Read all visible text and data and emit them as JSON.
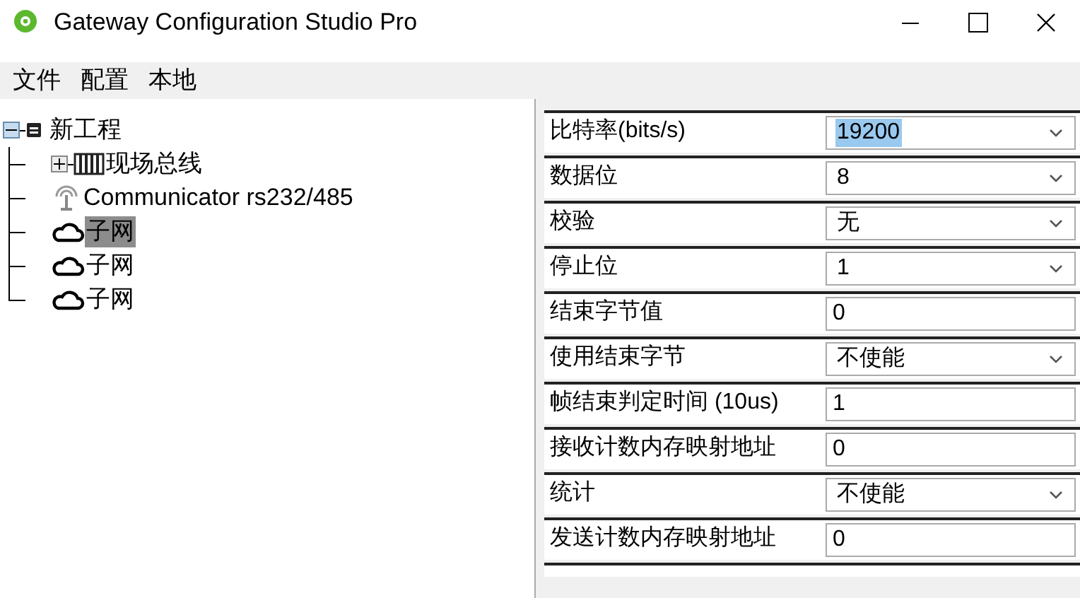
{
  "window": {
    "title": "Gateway Configuration Studio Pro"
  },
  "menu": [
    "文件",
    "配置",
    "本地"
  ],
  "tree": [
    {
      "label": "新工程",
      "kind": "project",
      "expanded": true,
      "selected": false,
      "children": [
        {
          "label": "现场总线",
          "kind": "bus",
          "expanded": false,
          "selected": false
        },
        {
          "label": "Communicator rs232/485",
          "kind": "antenna",
          "selected": false
        },
        {
          "label": "子网",
          "kind": "cloud",
          "selected": true
        },
        {
          "label": "子网",
          "kind": "cloud",
          "selected": false
        },
        {
          "label": "子网",
          "kind": "cloud",
          "selected": false
        }
      ]
    }
  ],
  "properties": [
    {
      "label": "比特率(bits/s)",
      "kind": "select",
      "value": "19200",
      "selected": true
    },
    {
      "label": "数据位",
      "kind": "select",
      "value": "8",
      "selected": false
    },
    {
      "label": "校验",
      "kind": "select",
      "value": "无",
      "selected": false
    },
    {
      "label": "停止位",
      "kind": "select",
      "value": "1",
      "selected": false
    },
    {
      "label": "结束字节值",
      "kind": "text",
      "value": "0",
      "selected": false
    },
    {
      "label": "使用结束字节",
      "kind": "select",
      "value": "不使能",
      "selected": false
    },
    {
      "label": "帧结束判定时间 (10us)",
      "kind": "text",
      "value": "1",
      "selected": false
    },
    {
      "label": "接收计数内存映射地址",
      "kind": "text",
      "value": "0",
      "selected": false
    },
    {
      "label": "统计",
      "kind": "select",
      "value": "不使能",
      "selected": false
    },
    {
      "label": "发送计数内存映射地址",
      "kind": "text",
      "value": "0",
      "selected": false
    }
  ]
}
